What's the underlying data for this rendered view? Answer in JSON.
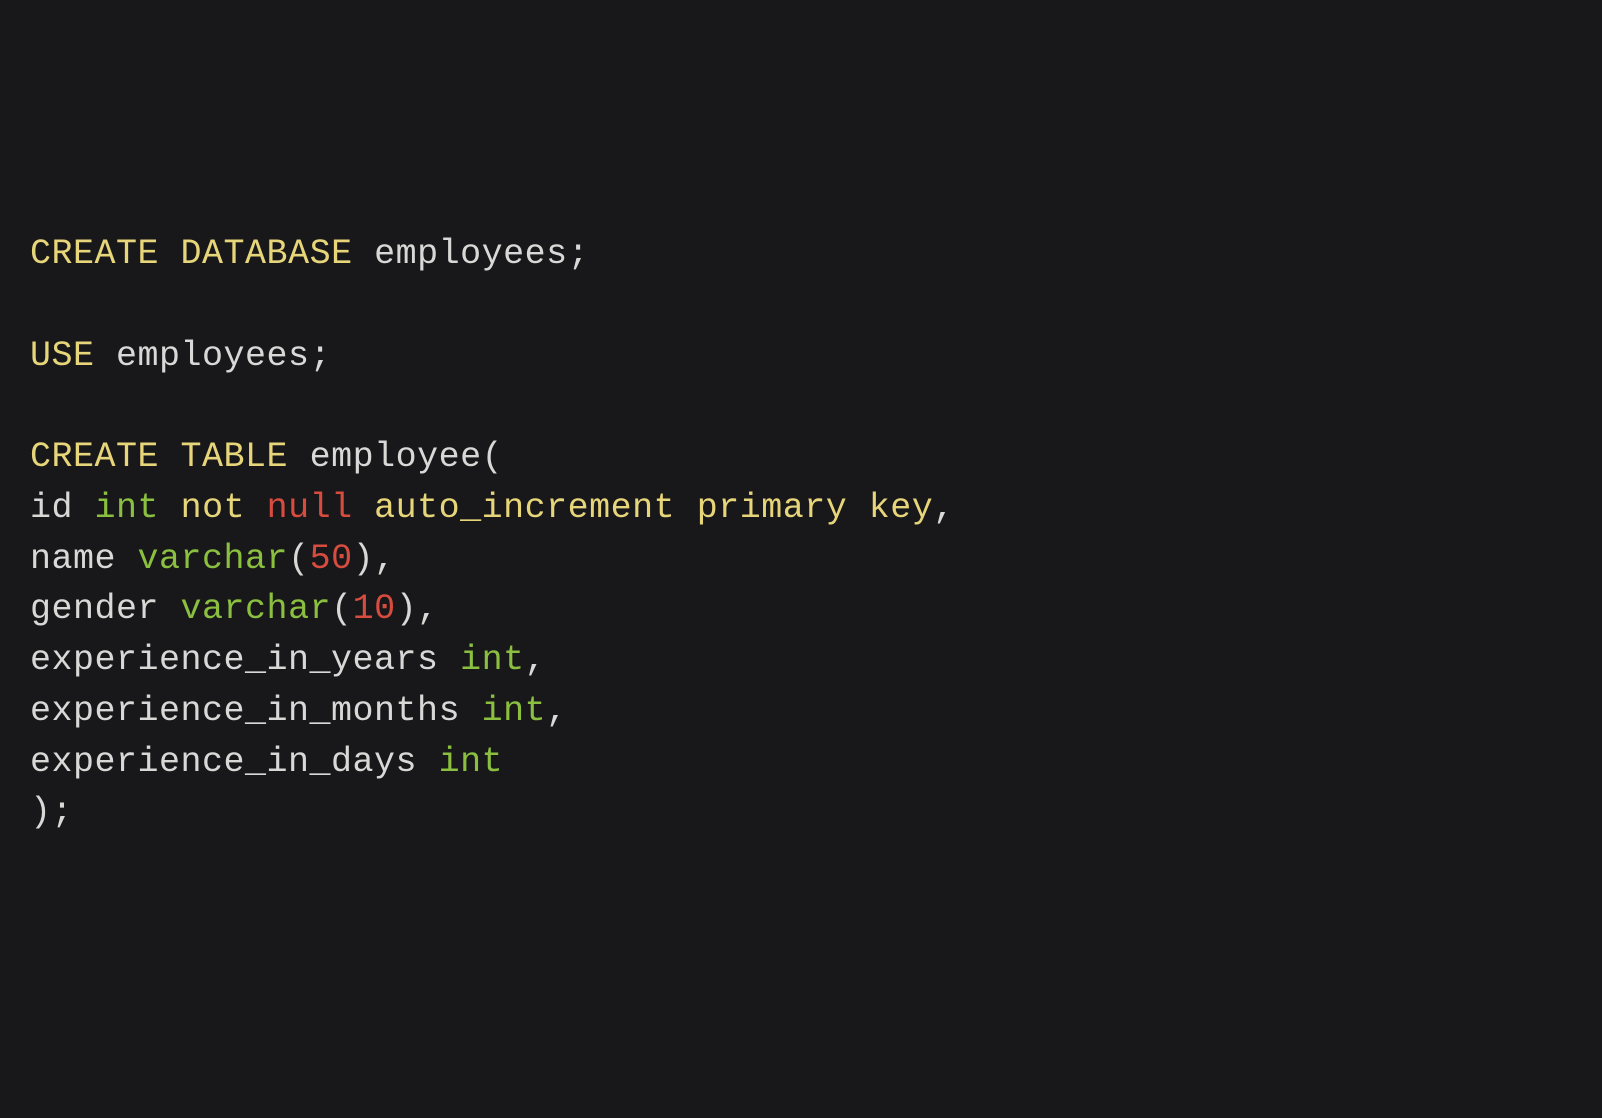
{
  "code": {
    "l01": {
      "kw1": "CREATE",
      "kw2": "DATABASE",
      "id1": "employees",
      "pn1": ";"
    },
    "l02": "",
    "l03": {
      "kw1": "USE",
      "id1": "employees",
      "pn1": ";"
    },
    "l04": "",
    "l05": {
      "kw1": "CREATE",
      "kw2": "TABLE",
      "id1": "employee",
      "pn1": "("
    },
    "l06": {
      "id1": "id",
      "ty1": "int",
      "kw1": "not",
      "null1": "null",
      "kw2": "auto_increment",
      "kw3": "primary",
      "kw4": "key",
      "pn1": ","
    },
    "l07": {
      "id1": "name",
      "ty1": "varchar",
      "pn1": "(",
      "num1": "50",
      "pn2": "),",
      "pn_close": ")"
    },
    "l08": {
      "id1": "gender",
      "ty1": "varchar",
      "pn1": "(",
      "num1": "10",
      "pn2": "),"
    },
    "l09": {
      "id1": "experience_in_years",
      "ty1": "int",
      "pn1": ","
    },
    "l10": {
      "id1": "experience_in_months",
      "ty1": "int",
      "pn1": ","
    },
    "l11": {
      "id1": "experience_in_days",
      "ty1": "int"
    },
    "l12": {
      "pn1": ");"
    }
  }
}
